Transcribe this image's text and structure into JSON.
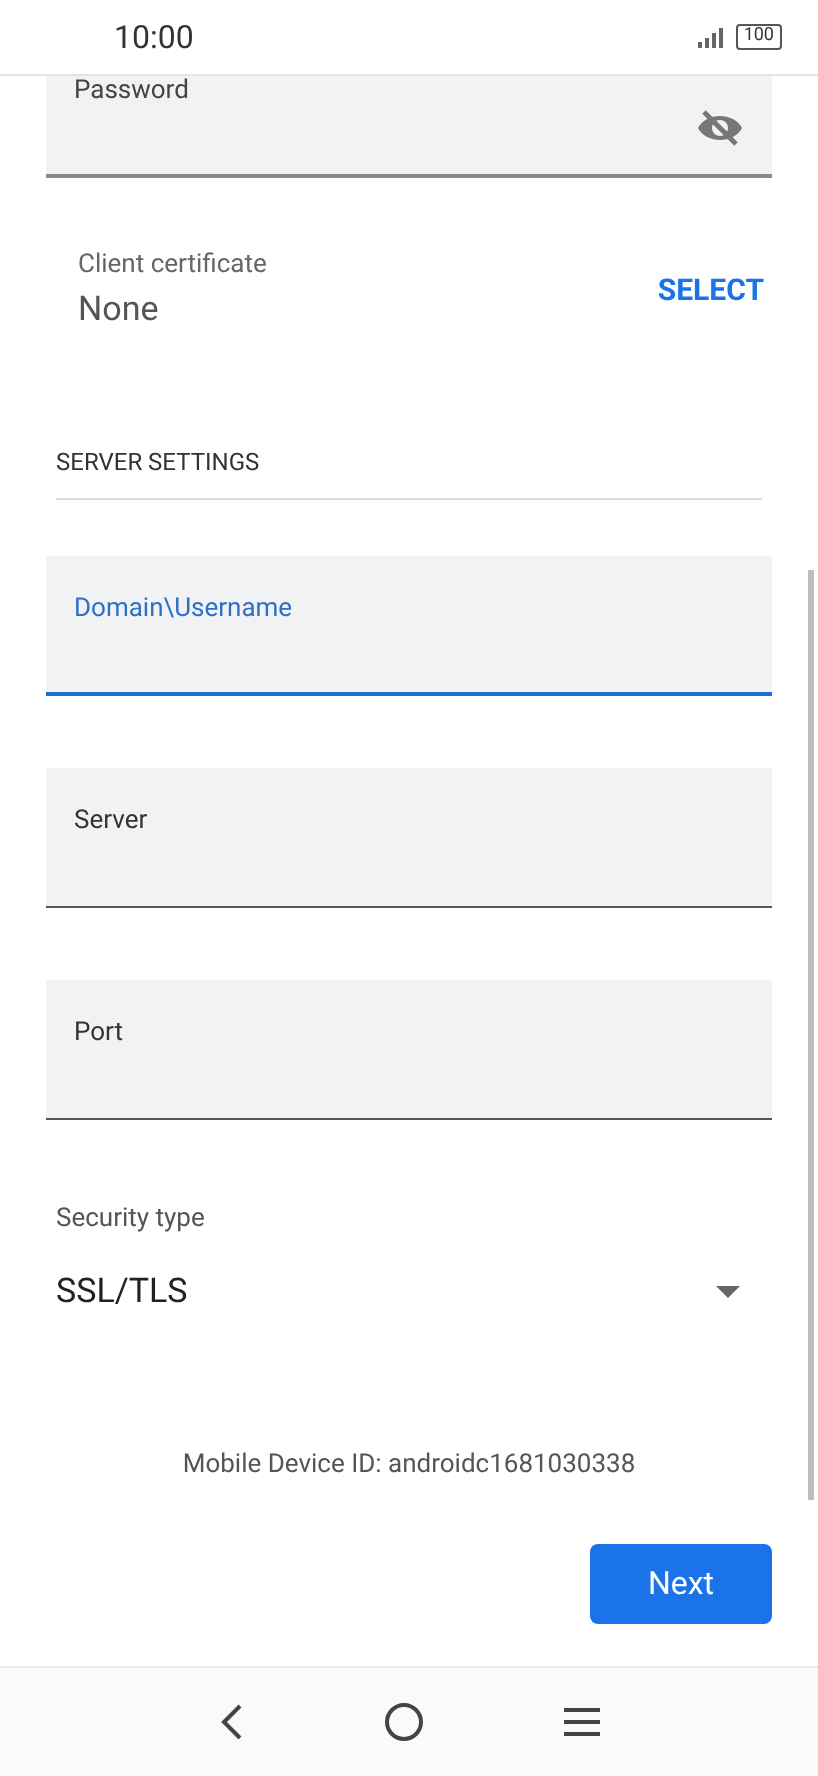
{
  "status_bar": {
    "time": "10:00",
    "battery": "100"
  },
  "password_field": {
    "label": "Password"
  },
  "client_certificate": {
    "label": "Client certificate",
    "value": "None",
    "action": "SELECT"
  },
  "section_title": "SERVER SETTINGS",
  "fields": [
    {
      "label": "Domain\\Username",
      "focused": true
    },
    {
      "label": "Server",
      "focused": false
    },
    {
      "label": "Port",
      "focused": false
    }
  ],
  "security_type": {
    "label": "Security type",
    "value": "SSL/TLS"
  },
  "device_id": "Mobile Device ID: androidc1681030338",
  "next_button": "Next"
}
